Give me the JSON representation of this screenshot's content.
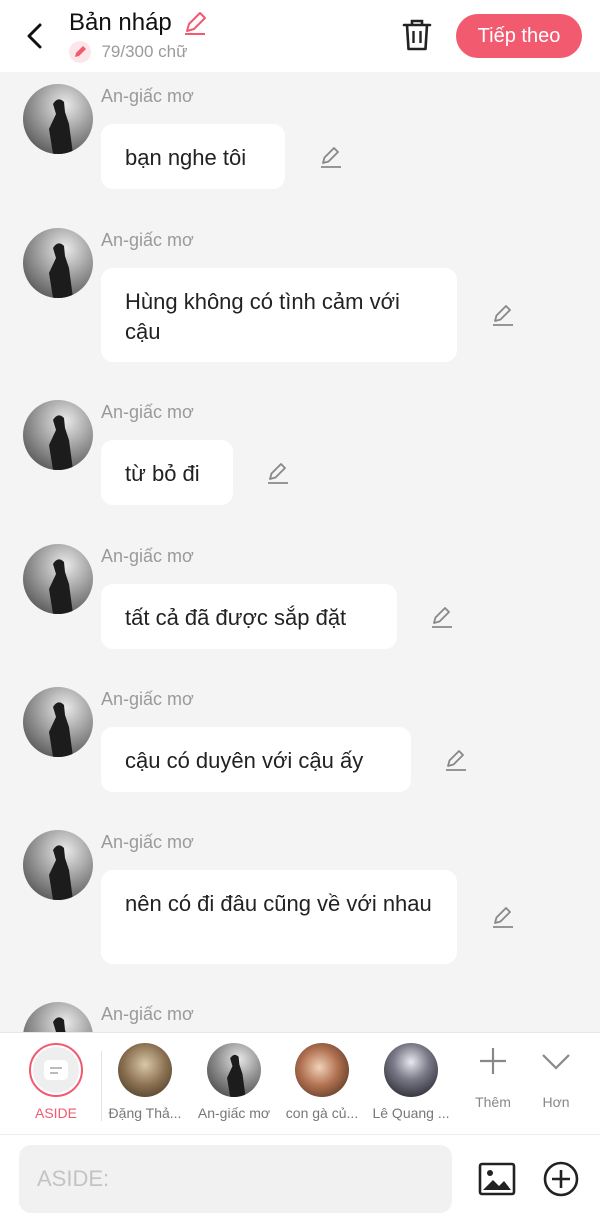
{
  "header": {
    "title": "Bản nháp",
    "word_count": "79/300 chữ",
    "next_label": "Tiếp theo",
    "accent": "#f25a70"
  },
  "messages": [
    {
      "sender": "An-giấc mơ",
      "text": "bạn nghe tôi"
    },
    {
      "sender": "An-giấc mơ",
      "text": "Hùng không có tình cảm với cậu"
    },
    {
      "sender": "An-giấc mơ",
      "text": "từ bỏ đi"
    },
    {
      "sender": "An-giấc mơ",
      "text": "tất cả đã được sắp đặt"
    },
    {
      "sender": "An-giấc mơ",
      "text": "cậu có duyên với cậu ấy"
    },
    {
      "sender": "An-giấc mơ",
      "text": "nên có đi đâu cũng về với nhau"
    },
    {
      "sender": "An-giấc mơ",
      "text": ""
    }
  ],
  "characters": [
    {
      "name": "ASIDE",
      "icon": "message-icon"
    },
    {
      "name": "Đặng Thả..."
    },
    {
      "name": "An-giấc mơ"
    },
    {
      "name": "con gà củ..."
    },
    {
      "name": "Lê Quang ..."
    }
  ],
  "tools": {
    "add_label": "Thêm",
    "more_label": "Hơn"
  },
  "composer": {
    "placeholder": "ASIDE:"
  }
}
